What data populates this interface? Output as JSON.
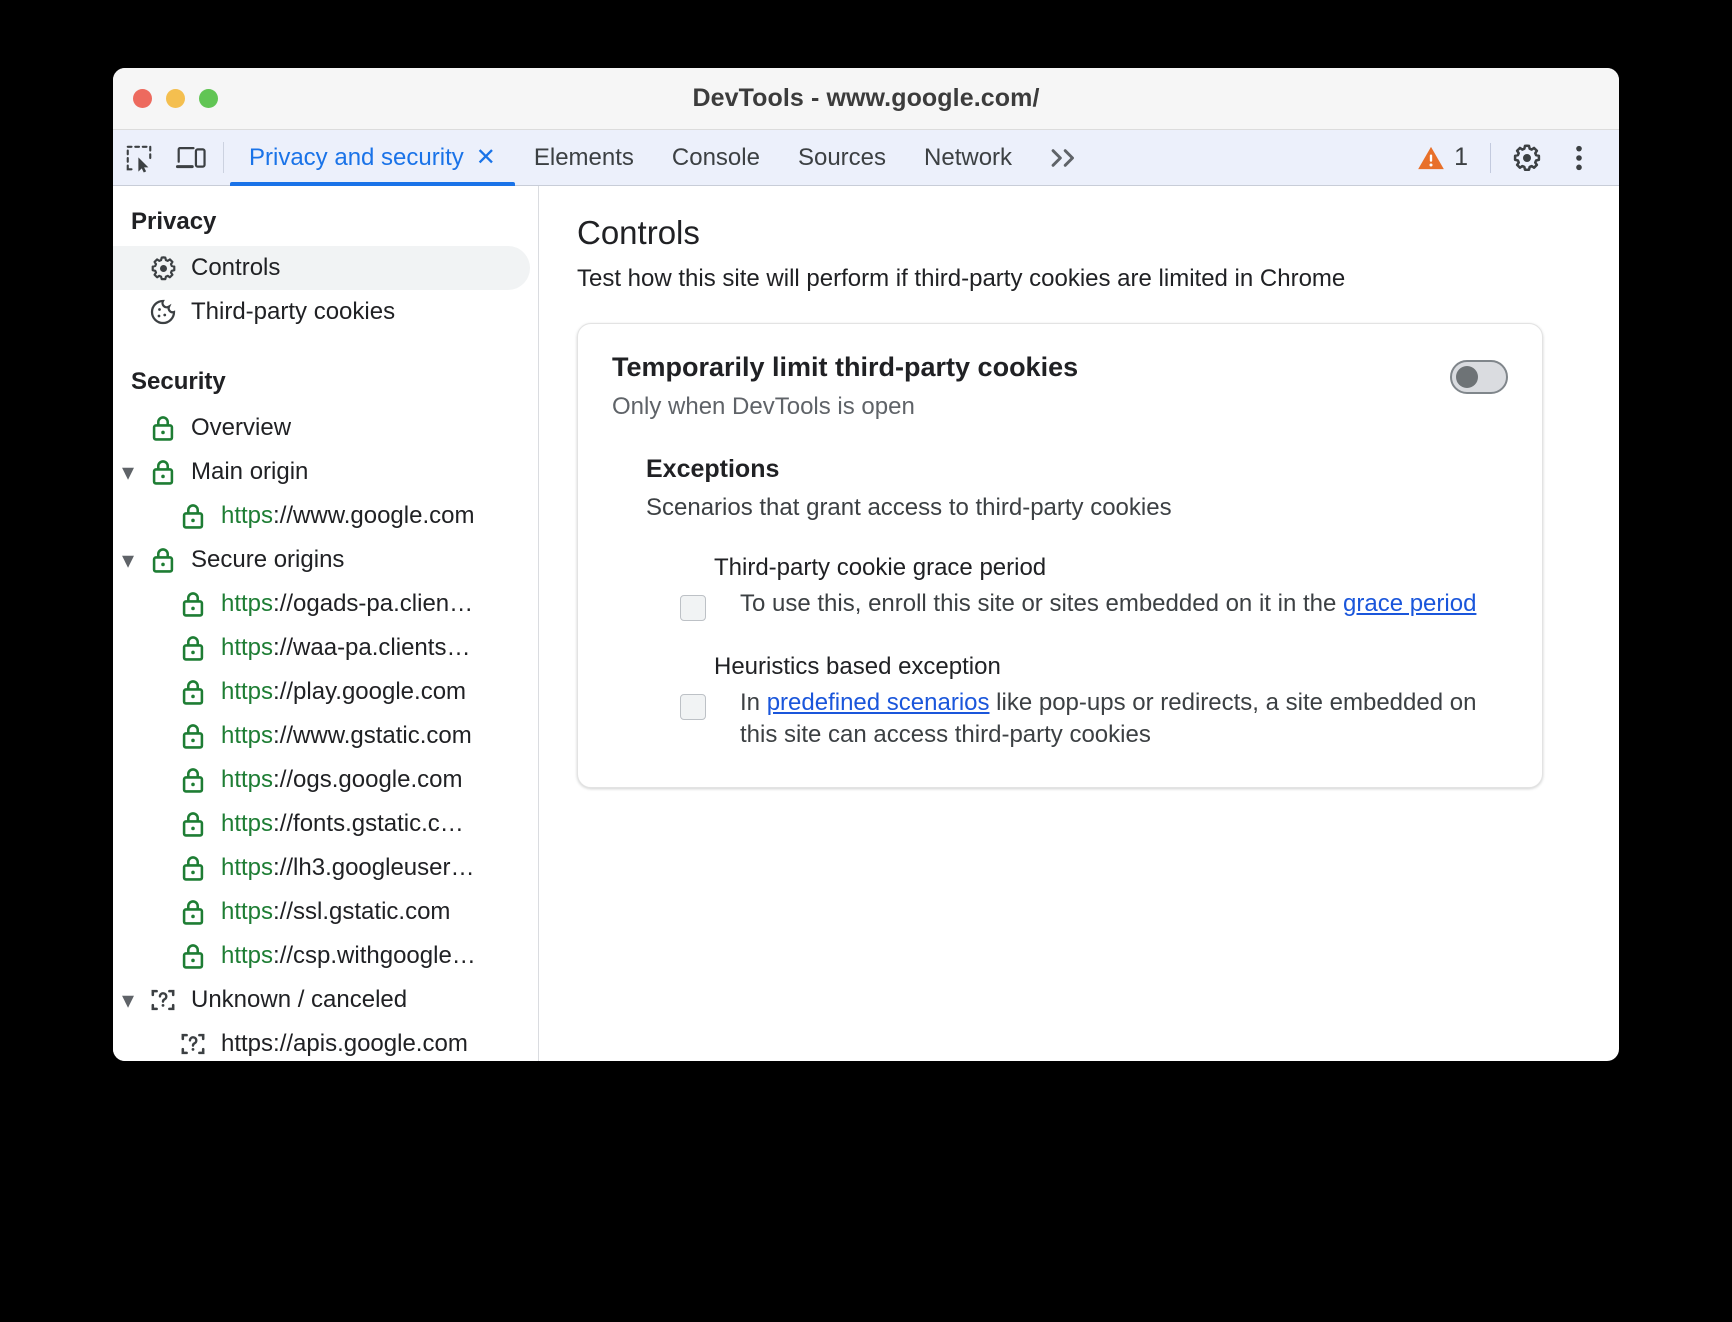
{
  "window": {
    "title": "DevTools - www.google.com/",
    "traffic_lights": [
      "close",
      "minimize",
      "maximize"
    ]
  },
  "tabbar": {
    "left_icons": [
      {
        "name": "inspect-element-icon"
      },
      {
        "name": "device-toolbar-icon"
      }
    ],
    "tabs": [
      {
        "label": "Privacy and security",
        "active": true,
        "closable": true,
        "close_glyph": "✕"
      },
      {
        "label": "Elements",
        "active": false
      },
      {
        "label": "Console",
        "active": false
      },
      {
        "label": "Sources",
        "active": false
      },
      {
        "label": "Network",
        "active": false
      }
    ],
    "more_tabs_glyph": "»",
    "warning_count": "1",
    "right_icons": [
      {
        "name": "settings-gear-icon"
      },
      {
        "name": "more-options-icon"
      }
    ]
  },
  "sidebar": {
    "sections": [
      {
        "heading": "Privacy",
        "items": [
          {
            "label": "Controls",
            "icon": "gear-icon",
            "selected": true,
            "indent": 1
          },
          {
            "label": "Third-party cookies",
            "icon": "cookie-icon",
            "selected": false,
            "indent": 1
          }
        ]
      },
      {
        "heading": "Security",
        "items": [
          {
            "label": "Overview",
            "icon": "lock-icon",
            "indent": 1,
            "twisty": ""
          },
          {
            "label": "Main origin",
            "icon": "lock-icon",
            "indent": 0,
            "twisty": "▾"
          },
          {
            "scheme": "https",
            "host": "://www.google.com",
            "icon": "lock-icon",
            "indent": 2
          },
          {
            "label": "Secure origins",
            "icon": "lock-icon",
            "indent": 0,
            "twisty": "▾"
          },
          {
            "scheme": "https",
            "host": "://ogads-pa.clien…",
            "icon": "lock-icon",
            "indent": 2
          },
          {
            "scheme": "https",
            "host": "://waa-pa.clients…",
            "icon": "lock-icon",
            "indent": 2
          },
          {
            "scheme": "https",
            "host": "://play.google.com",
            "icon": "lock-icon",
            "indent": 2
          },
          {
            "scheme": "https",
            "host": "://www.gstatic.com",
            "icon": "lock-icon",
            "indent": 2
          },
          {
            "scheme": "https",
            "host": "://ogs.google.com",
            "icon": "lock-icon",
            "indent": 2
          },
          {
            "scheme": "https",
            "host": "://fonts.gstatic.c…",
            "icon": "lock-icon",
            "indent": 2
          },
          {
            "scheme": "https",
            "host": "://lh3.googleuser…",
            "icon": "lock-icon",
            "indent": 2
          },
          {
            "scheme": "https",
            "host": "://ssl.gstatic.com",
            "icon": "lock-icon",
            "indent": 2
          },
          {
            "scheme": "https",
            "host": "://csp.withgoogle…",
            "icon": "lock-icon",
            "indent": 2
          },
          {
            "label": "Unknown / canceled",
            "icon": "unknown-origin-icon",
            "indent": 0,
            "twisty": "▾"
          },
          {
            "label": "https://apis.google.com",
            "icon": "unknown-origin-icon",
            "indent": 2
          }
        ]
      }
    ]
  },
  "main": {
    "title": "Controls",
    "subtitle": "Test how this site will perform if third-party cookies are limited in Chrome",
    "card": {
      "title": "Temporarily limit third-party cookies",
      "subtitle": "Only when DevTools is open",
      "toggle_on": false,
      "exceptions": {
        "title": "Exceptions",
        "subtitle": "Scenarios that grant access to third-party cookies",
        "items": [
          {
            "name": "Third-party cookie grace period",
            "checked": false,
            "desc_before": "To use this, enroll this site or sites embedded on it in the ",
            "link": "grace period",
            "desc_after": ""
          },
          {
            "name": "Heuristics based exception",
            "checked": false,
            "desc_before": "In ",
            "link": "predefined scenarios",
            "desc_after": " like pop-ups or redirects, a site embedded on this site can access third-party cookies"
          }
        ]
      }
    }
  },
  "colors": {
    "accent": "#1a73e8",
    "tabbar_bg": "#ecf0fb",
    "secure_green": "#1e7d34",
    "link": "#1a56db",
    "warning_orange": "#e8702a"
  }
}
